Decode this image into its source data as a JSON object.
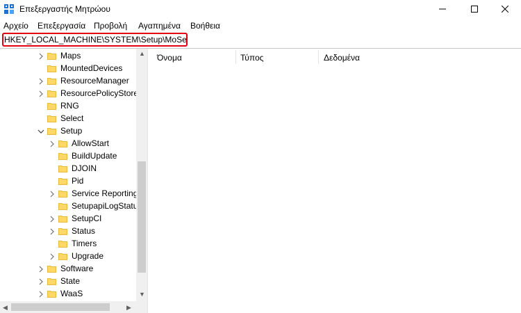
{
  "window": {
    "title": "Επεξεργαστής Μητρώου",
    "controls": {
      "minimize": "minimize",
      "maximize": "maximize",
      "close": "close"
    }
  },
  "menu": [
    "Αρχείο",
    "Επεξεργασία",
    "Προβολή",
    "Αγαπημένα",
    "Βοήθεια"
  ],
  "address": {
    "value": "HKEY_LOCAL_MACHINE\\SYSTEM\\Setup\\MoSetup"
  },
  "tree": {
    "items": [
      {
        "label": "Maps",
        "expander": "collapsed",
        "depth": 0
      },
      {
        "label": "MountedDevices",
        "expander": "none",
        "depth": 0
      },
      {
        "label": "ResourceManager",
        "expander": "collapsed",
        "depth": 0
      },
      {
        "label": "ResourcePolicyStore",
        "expander": "collapsed",
        "depth": 0
      },
      {
        "label": "RNG",
        "expander": "none",
        "depth": 0
      },
      {
        "label": "Select",
        "expander": "none",
        "depth": 0
      },
      {
        "label": "Setup",
        "expander": "expanded",
        "depth": 0
      },
      {
        "label": "AllowStart",
        "expander": "collapsed",
        "depth": 1
      },
      {
        "label": "BuildUpdate",
        "expander": "none",
        "depth": 1
      },
      {
        "label": "DJOIN",
        "expander": "none",
        "depth": 1
      },
      {
        "label": "Pid",
        "expander": "none",
        "depth": 1
      },
      {
        "label": "Service Reporting",
        "expander": "collapsed",
        "depth": 1
      },
      {
        "label": "SetupapiLogStatus",
        "expander": "none",
        "depth": 1
      },
      {
        "label": "SetupCI",
        "expander": "collapsed",
        "depth": 1
      },
      {
        "label": "Status",
        "expander": "collapsed",
        "depth": 1
      },
      {
        "label": "Timers",
        "expander": "none",
        "depth": 1
      },
      {
        "label": "Upgrade",
        "expander": "collapsed",
        "depth": 1
      },
      {
        "label": "Software",
        "expander": "collapsed",
        "depth": 0
      },
      {
        "label": "State",
        "expander": "collapsed",
        "depth": 0
      },
      {
        "label": "WaaS",
        "expander": "collapsed",
        "depth": 0
      }
    ]
  },
  "list": {
    "columns": [
      "Όνομα",
      "Τύπος",
      "Δεδομένα"
    ]
  },
  "colors": {
    "highlight_border": "#e0000f",
    "folder_fill": "#ffd866",
    "folder_edge": "#e8b93c",
    "icon_blue": "#1e73d2"
  },
  "icons": {
    "app": "registry-editor-icon",
    "folder": "folder-icon",
    "chevron_right": "chevron-right-icon",
    "chevron_down": "chevron-down-icon"
  }
}
